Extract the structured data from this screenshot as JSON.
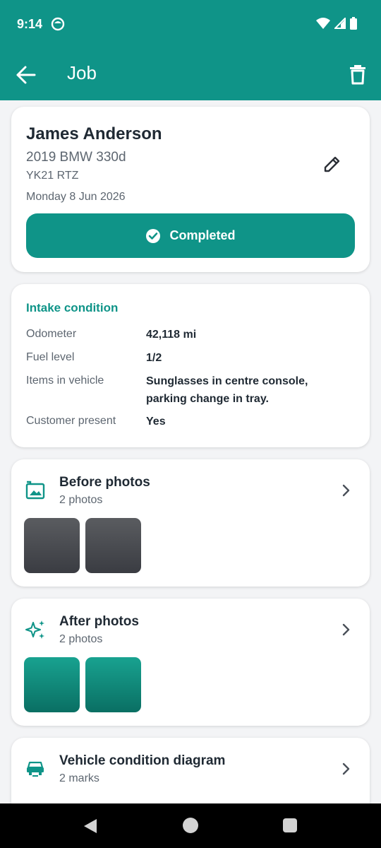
{
  "status_bar": {
    "time": "9:14"
  },
  "app_bar": {
    "title": "Job"
  },
  "job": {
    "customer_name": "James Anderson",
    "vehicle": "2019 BMW 330d",
    "plate": "YK21 RTZ",
    "date": "Monday 8 Jun 2026",
    "status_label": "Completed"
  },
  "intake": {
    "title": "Intake condition",
    "rows": [
      {
        "label": "Odometer",
        "value": "42,118 mi"
      },
      {
        "label": "Fuel level",
        "value": "1/2"
      },
      {
        "label": "Items in vehicle",
        "value": "Sunglasses in centre console, parking change in tray."
      },
      {
        "label": "Customer present",
        "value": "Yes"
      }
    ]
  },
  "before_photos": {
    "title": "Before photos",
    "count": "2 photos",
    "icon": "image-icon"
  },
  "after_photos": {
    "title": "After photos",
    "count": "2 photos",
    "icon": "sparkles-icon"
  },
  "diagram": {
    "title": "Vehicle condition diagram",
    "count": "2 marks",
    "icon": "car-icon"
  },
  "colors": {
    "primary": "#0f9488",
    "background": "#f3f4f6",
    "text": "#1f2933",
    "muted": "#5d6670"
  }
}
